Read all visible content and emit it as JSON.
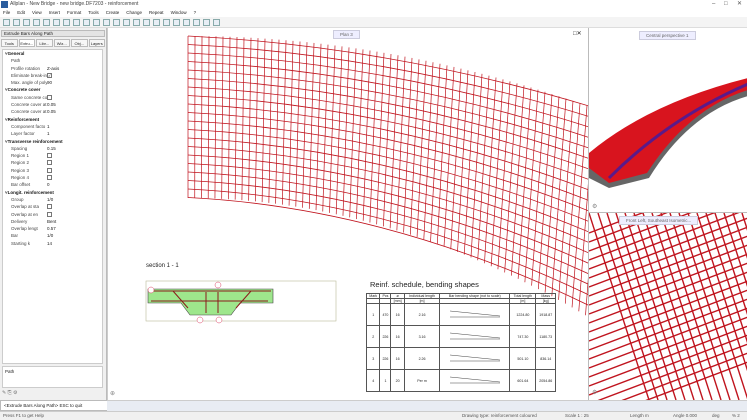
{
  "window": {
    "title": "Allplan - New Bridge - new bridge.DF7203 - reinforcement"
  },
  "menu": [
    "File",
    "Edit",
    "View",
    "Insert",
    "Format",
    "Tools",
    "Create",
    "Change",
    "Repeat",
    "Window",
    "?"
  ],
  "left_panel": {
    "header": "Extrude Bars Along Path",
    "tabs": [
      "Tools",
      "Extru...",
      "Libr...",
      "Wiz...",
      "Obj...",
      "Layers"
    ],
    "properties": [
      {
        "k": "General",
        "v": "",
        "group": true
      },
      {
        "k": "Path",
        "v": ""
      },
      {
        "k": "Profile rotation",
        "v": "Z-axis"
      },
      {
        "k": "Eliminate break-in",
        "v": "",
        "check": true,
        "checked": true
      },
      {
        "k": "Max. angle of poly",
        "v": "90"
      },
      {
        "k": "Concrete cover",
        "v": "",
        "group": true
      },
      {
        "k": "Same concrete co",
        "v": "",
        "check": true
      },
      {
        "k": "Concrete cover at",
        "v": "0.05"
      },
      {
        "k": "Concrete cover at",
        "v": "0.05"
      },
      {
        "k": "Reinforcement",
        "v": "",
        "group": true
      },
      {
        "k": "Component facto",
        "v": "1"
      },
      {
        "k": "Layer factor",
        "v": "1"
      },
      {
        "k": "Transverse reinforcement",
        "v": "",
        "group": true
      },
      {
        "k": "Spacing",
        "v": "0.15"
      },
      {
        "k": "Region 1",
        "v": "",
        "check": true
      },
      {
        "k": "Region 2",
        "v": "",
        "check": true
      },
      {
        "k": "Region 3",
        "v": "",
        "check": true
      },
      {
        "k": "Region 4",
        "v": "",
        "check": true
      },
      {
        "k": "Bar offset",
        "v": "0"
      },
      {
        "k": "Longit. reinforcement",
        "v": "",
        "group": true
      },
      {
        "k": "Group",
        "v": "1/0"
      },
      {
        "k": "Overlap at sta",
        "v": "",
        "check": true
      },
      {
        "k": "Overlap at en",
        "v": "",
        "check": true
      },
      {
        "k": "Delivery",
        "v": "Bent"
      },
      {
        "k": "Overlap lengt",
        "v": "0.57"
      },
      {
        "k": "Bar",
        "v": "1/0"
      },
      {
        "k": "Starting k",
        "v": "14"
      }
    ],
    "path_label": "Path",
    "prompt": "<Extrude Bars Along Path> ESC to quit"
  },
  "status": {
    "help": "Press F1 to get Help",
    "drawing_type": "Drawing type:  reinforcement coloured",
    "scale": "Scale  1 : 25",
    "length": "Length  m",
    "angle": "Angle  0.000",
    "deg": "deg",
    "percent": "% 2"
  },
  "viewports": {
    "plan": "Plan 3",
    "persp1": "Central perspective 1",
    "persp2": "Front Left, Southeast Isometric..."
  },
  "section": {
    "title": "section 1 - 1"
  },
  "schedule": {
    "title": "Reinf. schedule, bending shapes",
    "headers": [
      "Mark",
      "Pcs",
      "ø",
      "Individual length",
      "Bar bending shape (not to scale)",
      "Total length",
      "Mass"
    ],
    "units": [
      "",
      "",
      "[mm]",
      "[m]",
      "",
      "[m]",
      "[kg]"
    ],
    "rows": [
      [
        "1",
        "470",
        "16",
        "2.16",
        "",
        "1224.80",
        "1918.87"
      ],
      [
        "2",
        "226",
        "16",
        "3.16",
        "",
        "747.30",
        "1180.73"
      ],
      [
        "3",
        "226",
        "16",
        "2.26",
        "",
        "501.10",
        "836.14"
      ],
      [
        "4",
        "1",
        "20",
        "Per m",
        "",
        "601.64",
        "2054.86"
      ]
    ]
  },
  "colors": {
    "rebar": "#c0141e",
    "concrete": "#9ee68c",
    "accent": "#2b5d9e"
  }
}
